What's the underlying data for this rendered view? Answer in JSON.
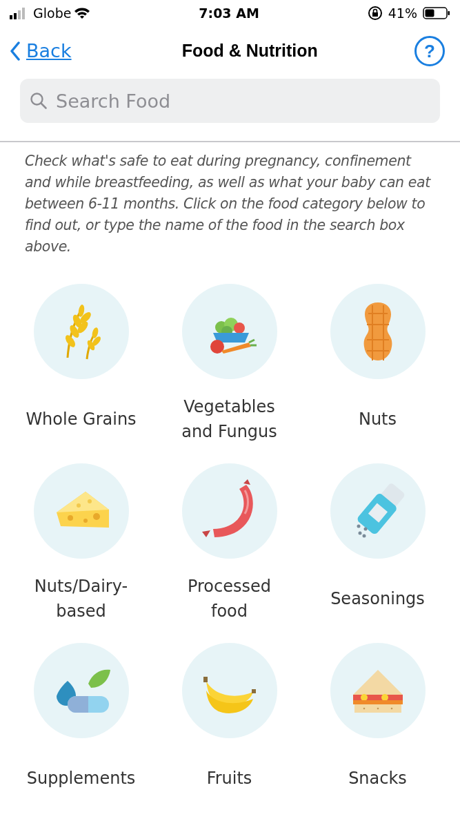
{
  "status_bar": {
    "carrier": "Globe",
    "time": "7:03 AM",
    "battery": "41%"
  },
  "nav": {
    "back": "Back",
    "title": "Food & Nutrition",
    "help": "?"
  },
  "search": {
    "placeholder": "Search Food"
  },
  "intro": "Check what's safe to eat during pregnancy, confinement and while breastfeeding, as well as what your baby can eat between 6-11 months. Click on the food category below to find out, or type the name of the food in the search box above.",
  "categories": [
    {
      "kind": "grains",
      "label": "Whole Grains"
    },
    {
      "kind": "vegetables",
      "label": "Vegetables and Fungus"
    },
    {
      "kind": "nuts",
      "label": "Nuts"
    },
    {
      "kind": "cheese",
      "label": "Nuts/Dairy-based"
    },
    {
      "kind": "sausage",
      "label": "Processed food"
    },
    {
      "kind": "salt",
      "label": "Seasonings"
    },
    {
      "kind": "supplements",
      "label": "Supplements"
    },
    {
      "kind": "fruits",
      "label": "Fruits"
    },
    {
      "kind": "snacks",
      "label": "Snacks"
    }
  ]
}
